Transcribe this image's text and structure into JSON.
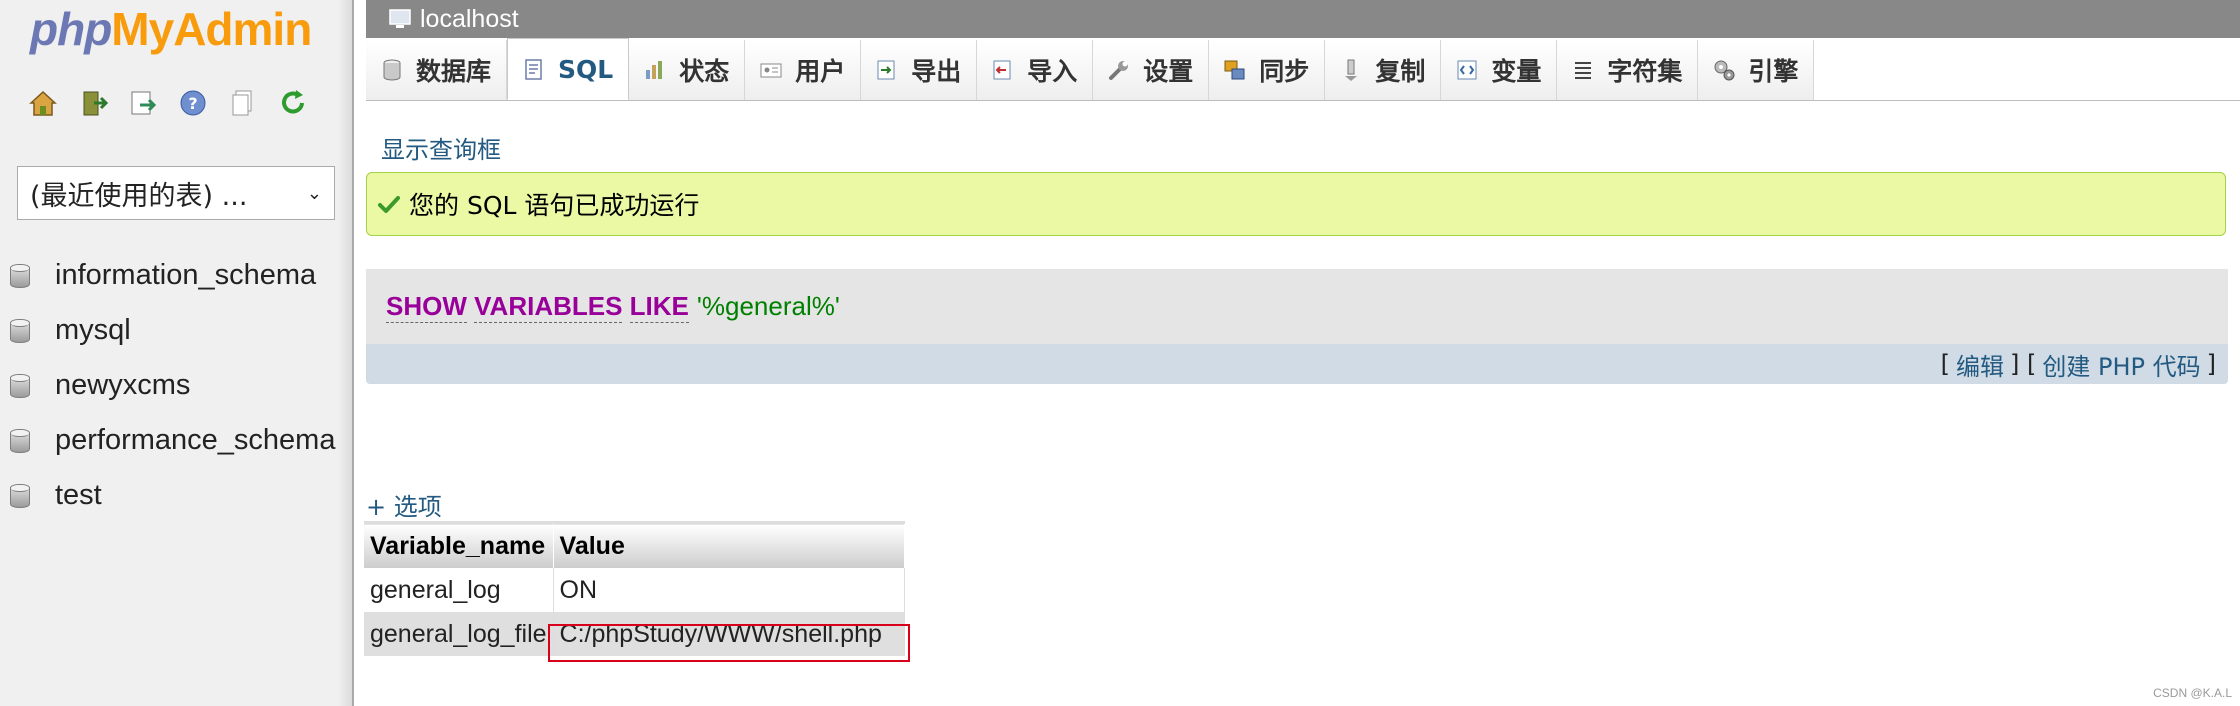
{
  "logo": {
    "php": "php",
    "my": "My",
    "admin": "Admin"
  },
  "nav": {
    "icons": [
      "home-icon",
      "logout-icon",
      "sql-query-icon",
      "help-icon",
      "docs-icon",
      "reload-icon"
    ],
    "db_select": {
      "value": "(最近使用的表) ..."
    },
    "databases": [
      {
        "name": "information_schema"
      },
      {
        "name": "mysql"
      },
      {
        "name": "newyxcms"
      },
      {
        "name": "performance_schema"
      },
      {
        "name": "test"
      }
    ]
  },
  "topbar": {
    "server": "localhost"
  },
  "tabs": [
    {
      "label": "数据库",
      "icon": "database-icon"
    },
    {
      "label": "SQL",
      "icon": "sql-icon",
      "active": true
    },
    {
      "label": "状态",
      "icon": "status-icon"
    },
    {
      "label": "用户",
      "icon": "users-icon"
    },
    {
      "label": "导出",
      "icon": "export-icon"
    },
    {
      "label": "导入",
      "icon": "import-icon"
    },
    {
      "label": "设置",
      "icon": "settings-icon"
    },
    {
      "label": "同步",
      "icon": "sync-icon"
    },
    {
      "label": "复制",
      "icon": "replication-icon"
    },
    {
      "label": "变量",
      "icon": "variables-icon"
    },
    {
      "label": "字符集",
      "icon": "charset-icon"
    },
    {
      "label": "引擎",
      "icon": "engine-icon"
    }
  ],
  "content": {
    "show_query_box": "显示查询框",
    "success_message": "您的 SQL 语句已成功运行",
    "sql": {
      "kw1": "SHOW",
      "kw2": "VARIABLES",
      "kw3": "LIKE",
      "string": "'%general%'"
    },
    "links": {
      "open": "[",
      "edit": "编辑",
      "mid": "] [",
      "create_php": "创建 PHP 代码",
      "close": "]"
    },
    "options": "+ 选项",
    "results": {
      "columns": [
        "Variable_name",
        "Value"
      ],
      "rows": [
        [
          "general_log",
          "ON"
        ],
        [
          "general_log_file",
          "C:/phpStudy/WWW/shell.php"
        ]
      ]
    }
  },
  "watermark": "CSDN @K.A.L",
  "colors": {
    "link": "#235a81",
    "keyword": "#990099",
    "string": "#008000",
    "success_bg": "#ebf8a4",
    "highlight_box": "#d9001b"
  }
}
